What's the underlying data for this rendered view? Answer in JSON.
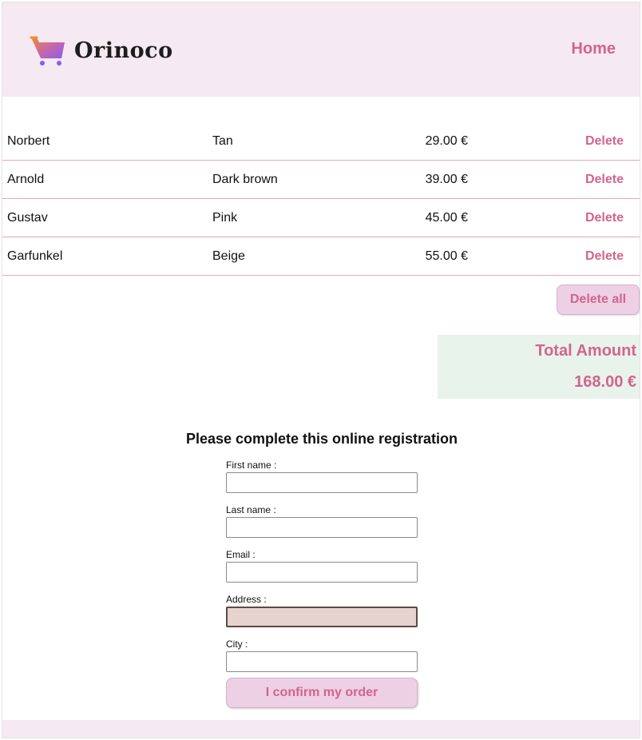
{
  "brand": {
    "name": "Orinoco"
  },
  "nav": {
    "home": "Home"
  },
  "cart": {
    "items": [
      {
        "name": "Norbert",
        "color": "Tan",
        "price": "29.00 €",
        "action": "Delete"
      },
      {
        "name": "Arnold",
        "color": "Dark brown",
        "price": "39.00 €",
        "action": "Delete"
      },
      {
        "name": "Gustav",
        "color": "Pink",
        "price": "45.00 €",
        "action": "Delete"
      },
      {
        "name": "Garfunkel",
        "color": "Beige",
        "price": "55.00 €",
        "action": "Delete"
      }
    ],
    "delete_all": "Delete all"
  },
  "total": {
    "label": "Total Amount",
    "amount": "168.00 €"
  },
  "form": {
    "title": "Please complete this online registration",
    "first_name": {
      "label": "First name :",
      "value": ""
    },
    "last_name": {
      "label": "Last name :",
      "value": ""
    },
    "email": {
      "label": "Email :",
      "value": ""
    },
    "address": {
      "label": "Address :",
      "value": ""
    },
    "city": {
      "label": "City :",
      "value": ""
    },
    "submit": "I confirm my order"
  },
  "colors": {
    "accent": "#d2648e",
    "header_bg": "#f5eaf1",
    "button_bg": "#edd0e3",
    "total_bg": "#e8f3eb",
    "focused_input_bg": "#e6d3cf"
  },
  "icons": {
    "logo": "shopping-cart-icon"
  }
}
